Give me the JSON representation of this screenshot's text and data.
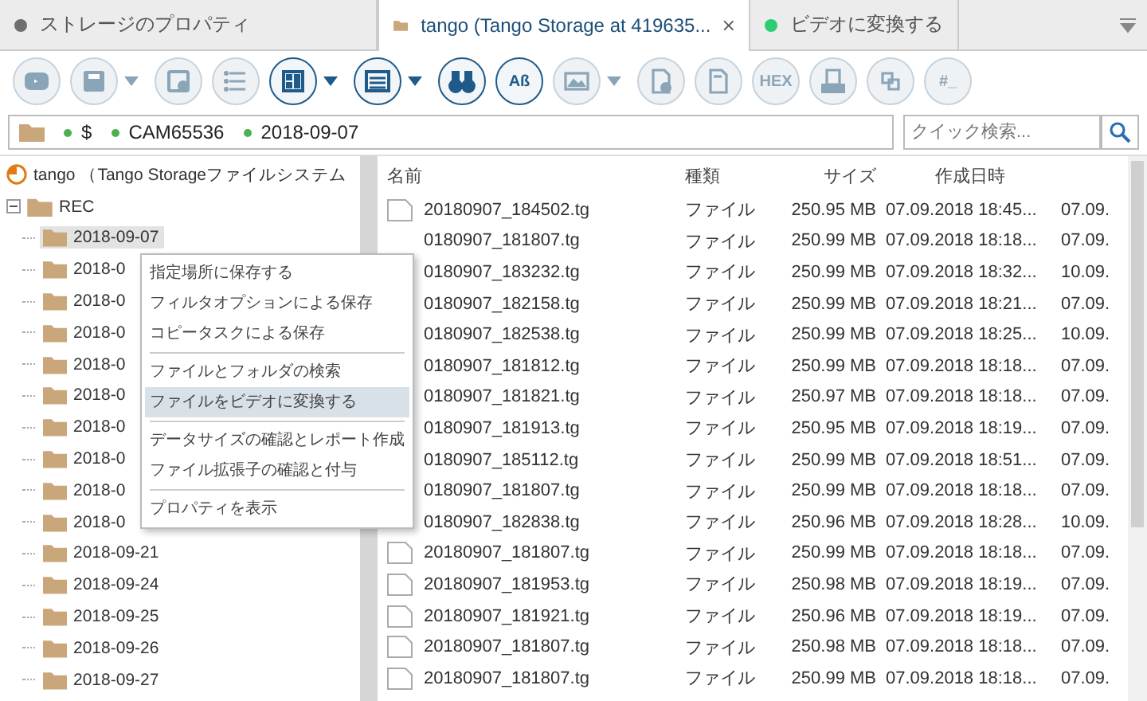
{
  "tabs": [
    {
      "kind": "dot",
      "label": "ストレージのプロパティ",
      "color": "#6e6e6e",
      "selected": false,
      "closable": false
    },
    {
      "kind": "folder",
      "label": "tango (Tango Storage at 419635...",
      "selected": true,
      "closable": true
    },
    {
      "kind": "dot",
      "label": "ビデオに変換する",
      "color": "#2ecc71",
      "selected": false,
      "closable": false
    }
  ],
  "toolbar": [
    {
      "enabled": false,
      "dropdown": false
    },
    {
      "enabled": false,
      "dropdown": true
    },
    {
      "enabled": false,
      "dropdown": false
    },
    {
      "enabled": false,
      "dropdown": false
    },
    {
      "enabled": true,
      "dropdown": true
    },
    {
      "enabled": true,
      "dropdown": true
    },
    {
      "enabled": true,
      "dropdown": false
    },
    {
      "enabled": true,
      "dropdown": false,
      "label": "Aß"
    },
    {
      "enabled": false,
      "dropdown": true
    },
    {
      "enabled": false,
      "dropdown": false
    },
    {
      "enabled": false,
      "dropdown": false
    },
    {
      "enabled": false,
      "dropdown": false,
      "label": "HEX"
    },
    {
      "enabled": false,
      "dropdown": false
    },
    {
      "enabled": false,
      "dropdown": false
    },
    {
      "enabled": false,
      "dropdown": false,
      "label": "#_"
    }
  ],
  "path": [
    {
      "label": "$",
      "color": "#4caf50"
    },
    {
      "label": "CAM65536",
      "color": "#4caf50"
    },
    {
      "label": "2018-09-07",
      "color": "#4caf50"
    }
  ],
  "search": {
    "placeholder": "クイック検索..."
  },
  "tree": [
    {
      "label": "tango （Tango Storageファイルシステム",
      "children": [
        {
          "label": "REC",
          "expanded": true,
          "children": [
            {
              "label": "2018-09-07",
              "selected": true
            },
            {
              "label": "2018-0",
              "selected": false
            },
            {
              "label": "2018-0",
              "selected": false
            },
            {
              "label": "2018-0",
              "selected": false
            },
            {
              "label": "2018-0",
              "selected": false
            },
            {
              "label": "2018-0",
              "selected": false
            },
            {
              "label": "2018-0",
              "selected": false
            },
            {
              "label": "2018-0",
              "selected": false
            },
            {
              "label": "2018-0",
              "selected": false
            },
            {
              "label": "2018-0",
              "selected": false
            },
            {
              "label": "2018-09-21",
              "selected": false
            },
            {
              "label": "2018-09-24",
              "selected": false
            },
            {
              "label": "2018-09-25",
              "selected": false
            },
            {
              "label": "2018-09-26",
              "selected": false
            },
            {
              "label": "2018-09-27",
              "selected": false
            }
          ]
        }
      ]
    }
  ],
  "table": {
    "columns": [
      "名前",
      "種類",
      "サイズ",
      "作成日時"
    ],
    "rows": [
      {
        "icon": true,
        "name": "20180907_184502.tg",
        "type": "ファイル",
        "size": "250.95 MB",
        "created": "07.09.2018 18:45...",
        "column_5": "07.09."
      },
      {
        "icon": false,
        "name": "0180907_181807.tg",
        "type": "ファイル",
        "size": "250.99 MB",
        "created": "07.09.2018 18:18...",
        "column_5": "07.09."
      },
      {
        "icon": false,
        "name": "0180907_183232.tg",
        "type": "ファイル",
        "size": "250.99 MB",
        "created": "07.09.2018 18:32...",
        "column_5": "10.09."
      },
      {
        "icon": false,
        "name": "0180907_182158.tg",
        "type": "ファイル",
        "size": "250.99 MB",
        "created": "07.09.2018 18:21...",
        "column_5": "07.09."
      },
      {
        "icon": false,
        "name": "0180907_182538.tg",
        "type": "ファイル",
        "size": "250.99 MB",
        "created": "07.09.2018 18:25...",
        "column_5": "10.09."
      },
      {
        "icon": false,
        "name": "0180907_181812.tg",
        "type": "ファイル",
        "size": "250.99 MB",
        "created": "07.09.2018 18:18...",
        "column_5": "07.09."
      },
      {
        "icon": false,
        "name": "0180907_181821.tg",
        "type": "ファイル",
        "size": "250.97 MB",
        "created": "07.09.2018 18:18...",
        "column_5": "07.09."
      },
      {
        "icon": false,
        "name": "0180907_181913.tg",
        "type": "ファイル",
        "size": "250.95 MB",
        "created": "07.09.2018 18:19...",
        "column_5": "07.09."
      },
      {
        "icon": false,
        "name": "0180907_185112.tg",
        "type": "ファイル",
        "size": "250.99 MB",
        "created": "07.09.2018 18:51...",
        "column_5": "07.09."
      },
      {
        "icon": false,
        "name": "0180907_181807.tg",
        "type": "ファイル",
        "size": "250.99 MB",
        "created": "07.09.2018 18:18...",
        "column_5": "07.09."
      },
      {
        "icon": false,
        "name": "0180907_182838.tg",
        "type": "ファイル",
        "size": "250.96 MB",
        "created": "07.09.2018 18:28...",
        "column_5": "10.09."
      },
      {
        "icon": true,
        "name": "20180907_181807.tg",
        "type": "ファイル",
        "size": "250.99 MB",
        "created": "07.09.2018 18:18...",
        "column_5": "07.09."
      },
      {
        "icon": true,
        "name": "20180907_181953.tg",
        "type": "ファイル",
        "size": "250.98 MB",
        "created": "07.09.2018 18:19...",
        "column_5": "07.09."
      },
      {
        "icon": true,
        "name": "20180907_181921.tg",
        "type": "ファイル",
        "size": "250.96 MB",
        "created": "07.09.2018 18:19...",
        "column_5": "07.09."
      },
      {
        "icon": true,
        "name": "20180907_181807.tg",
        "type": "ファイル",
        "size": "250.98 MB",
        "created": "07.09.2018 18:18...",
        "column_5": "07.09."
      },
      {
        "icon": true,
        "name": "20180907_181807.tg",
        "type": "ファイル",
        "size": "250.99 MB",
        "created": "07.09.2018 18:18...",
        "column_5": "07.09."
      }
    ]
  },
  "context_menu": [
    {
      "kind": "item",
      "label": "指定場所に保存する",
      "selected": false
    },
    {
      "kind": "item",
      "label": "フィルタオプションによる保存",
      "selected": false
    },
    {
      "kind": "item",
      "label": "コピータスクによる保存",
      "selected": false
    },
    {
      "kind": "separator"
    },
    {
      "kind": "item",
      "label": "ファイルとフォルダの検索",
      "selected": false
    },
    {
      "kind": "item",
      "label": "ファイルをビデオに変換する",
      "selected": true
    },
    {
      "kind": "separator"
    },
    {
      "kind": "item",
      "label": "データサイズの確認とレポート作成",
      "selected": false
    },
    {
      "kind": "item",
      "label": "ファイル拡張子の確認と付与",
      "selected": false
    },
    {
      "kind": "separator"
    },
    {
      "kind": "item",
      "label": "プロパティを表示",
      "selected": false
    }
  ]
}
